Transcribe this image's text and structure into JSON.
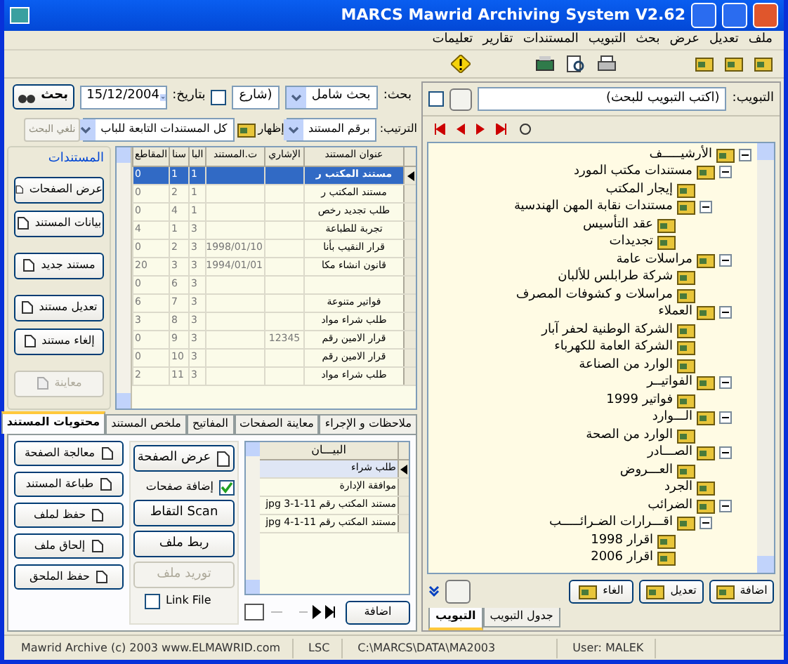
{
  "window": {
    "title": "MARCS Mawrid Archiving System V2.62"
  },
  "menu": [
    "ملف",
    "تعديل",
    "عرض",
    "بحث",
    "التبويب",
    "المستندات",
    "تقارير",
    "تعليمات"
  ],
  "search": {
    "label": "بحث:",
    "scope": "بحث شامل",
    "field": "(شارع",
    "date_label": "بتاريخ:",
    "date_checked": false,
    "date": "15/12/2004",
    "button": "بحث"
  },
  "sort": {
    "label": "الترتيب:",
    "order": "برقم المستند",
    "show_label": "إظهار",
    "show": "كل المستندات التابعة للباب",
    "cancel": "نلغي البحث"
  },
  "documents_panel": {
    "title": "المستندات",
    "buttons": [
      {
        "label": "عرض الصفحات",
        "disabled": false
      },
      {
        "label": "بيانات المستند",
        "disabled": false
      },
      {
        "label": "مستند جديد",
        "disabled": false
      },
      {
        "label": "تعديل مستند",
        "disabled": false
      },
      {
        "label": "إلغاء مستند",
        "disabled": false
      },
      {
        "label": "معاينة",
        "disabled": true
      }
    ]
  },
  "documents_table": {
    "columns": [
      "عنوان المستند",
      "الإشاري",
      "ت.المستند",
      "البا",
      "سنا",
      "المقاطع"
    ],
    "rows": [
      {
        "selected": true,
        "cells": [
          "مستند المكتب ر",
          "",
          "",
          "1",
          "1",
          "0"
        ]
      },
      {
        "selected": false,
        "cells": [
          "مستند المكتب ر",
          "",
          "",
          "1",
          "2",
          "0"
        ]
      },
      {
        "selected": false,
        "cells": [
          "طلب تجديد رخص",
          "",
          "",
          "1",
          "4",
          "0"
        ]
      },
      {
        "selected": false,
        "cells": [
          "تجربة للطباعة",
          "",
          "",
          "3",
          "1",
          "4"
        ]
      },
      {
        "selected": false,
        "cells": [
          "قرار النقيب بأنا",
          "",
          "1998/01/10",
          "3",
          "2",
          "0"
        ]
      },
      {
        "selected": false,
        "cells": [
          "قانون انشاء مكا",
          "",
          "1994/01/01",
          "3",
          "3",
          "20"
        ]
      },
      {
        "selected": false,
        "cells": [
          "",
          "",
          "",
          "3",
          "6",
          "0"
        ]
      },
      {
        "selected": false,
        "cells": [
          "فواتير متنوعة",
          "",
          "",
          "3",
          "7",
          "6"
        ]
      },
      {
        "selected": false,
        "cells": [
          "طلب شراء مواد",
          "",
          "",
          "3",
          "8",
          "3"
        ]
      },
      {
        "selected": false,
        "cells": [
          "قرار الامين رقم",
          "12345",
          "",
          "3",
          "9",
          "0"
        ]
      },
      {
        "selected": false,
        "cells": [
          "قرار الامين رقم",
          "",
          "",
          "3",
          "10",
          "0"
        ]
      },
      {
        "selected": false,
        "cells": [
          "طلب شراء مواد",
          "",
          "",
          "3",
          "11",
          "2"
        ]
      }
    ]
  },
  "bottom_tabs": [
    {
      "label": "ملاحظات و الإجراء",
      "selected": false
    },
    {
      "label": "معاينة الصفحات",
      "selected": false
    },
    {
      "label": "المفاتيح",
      "selected": false
    },
    {
      "label": "ملخص المستند",
      "selected": false
    },
    {
      "label": "محتويات المستند",
      "selected": true
    }
  ],
  "page_buttons": [
    {
      "label": "معالجة الصفحة",
      "disabled": false
    },
    {
      "label": "طباعة المستند",
      "disabled": false
    },
    {
      "label": "حفظ لملف",
      "disabled": false
    },
    {
      "label": "إلحاق ملف",
      "disabled": false
    },
    {
      "label": "حفظ الملحق",
      "disabled": false
    }
  ],
  "page_tools": {
    "view": "عرض الصفحة",
    "add_pages": {
      "label": "إضافة صفحات",
      "checked": true
    },
    "scan": "التقاط Scan",
    "link": "ربط ملف",
    "import": "توريد ملف",
    "link_file": {
      "label": "Link File",
      "checked": false
    }
  },
  "pages_table": {
    "column": "البيـــان",
    "rows": [
      {
        "text": "طلب شراء",
        "selected": true
      },
      {
        "text": "موافقة الإدارة",
        "selected": false
      },
      {
        "text": "مستند المكتب رقم 11-1-3 jpg",
        "selected": false
      },
      {
        "text": "مستند المكتب رقم 11-1-4 jpg",
        "selected": false
      }
    ]
  },
  "pages_nav": {
    "add": "اضافة"
  },
  "classification": {
    "label": "التبويب:",
    "value": "(اكتب التبويب للبحث)",
    "checked": false
  },
  "tree": [
    {
      "label": "الأرشيـــــف",
      "expanded": true,
      "children": [
        {
          "label": "مستندات مكتب المورد",
          "expanded": true,
          "children": [
            {
              "label": "إيجار المكتب"
            },
            {
              "label": "مستندات نقابة المهن الهندسية",
              "expanded": true,
              "children": [
                {
                  "label": "عقد التأسيس"
                },
                {
                  "label": "تجديدات"
                }
              ]
            }
          ]
        },
        {
          "label": "مراسلات عامة",
          "expanded": true,
          "children": [
            {
              "label": "شركة طرابلس للألبان"
            },
            {
              "label": "مراسلات و كشوفات المصرف"
            }
          ]
        },
        {
          "label": "العملاء",
          "expanded": true,
          "children": [
            {
              "label": "الشركة الوطنية لحفر آبار"
            },
            {
              "label": "الشركة العامة للكهرباء"
            },
            {
              "label": "الوارد من الصناعة"
            }
          ]
        },
        {
          "label": "الفواتيــر",
          "expanded": true,
          "children": [
            {
              "label": "فواتير 1999"
            }
          ]
        },
        {
          "label": "الـــوارد",
          "expanded": true,
          "children": [
            {
              "label": "الوارد من الصحة"
            }
          ]
        },
        {
          "label": "الصـــادر",
          "expanded": true,
          "children": [
            {
              "label": "العـــروض"
            }
          ]
        },
        {
          "label": "الجرد"
        },
        {
          "label": "الضرائب",
          "expanded": true,
          "children": [
            {
              "label": "اقـــرارات الضـرائـــــب",
              "expanded": true,
              "children": [
                {
                  "label": "اقرار 1998"
                },
                {
                  "label": "اقرار 2006"
                }
              ]
            }
          ]
        }
      ]
    }
  ],
  "tree_buttons": [
    "اضافة",
    "تعديل",
    "الغاء"
  ],
  "side_tabs": [
    {
      "label": "جدول التبويب",
      "selected": false
    },
    {
      "label": "التبويب",
      "selected": true
    }
  ],
  "status_bar": {
    "copyright": "Mawrid Archive (c) 2003 www.ELMAWRID.com",
    "company": "LSC",
    "path": "C:\\MARCS\\DATA\\MA2003",
    "user": "User: MALEK"
  }
}
